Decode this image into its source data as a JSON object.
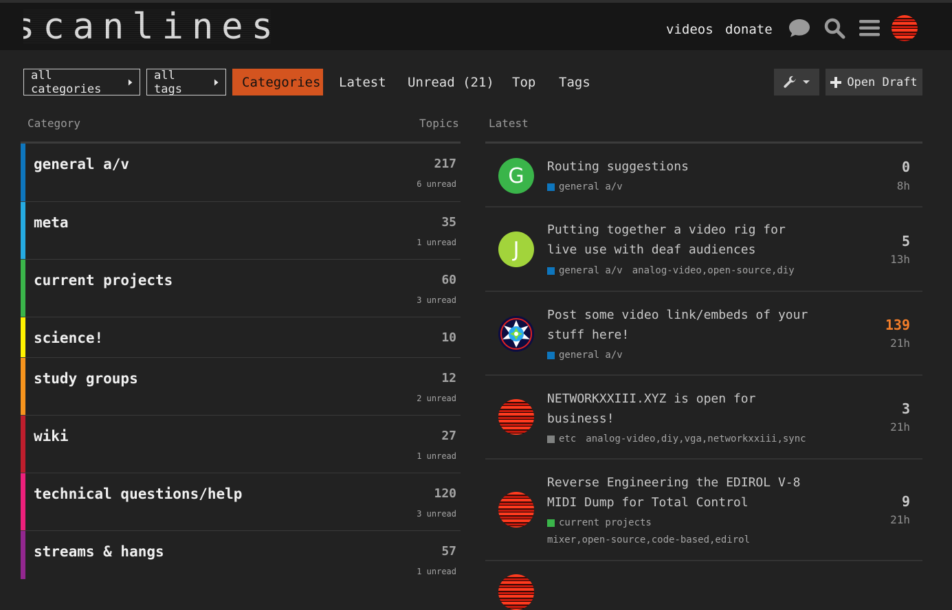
{
  "header": {
    "logo_text": "scanlines",
    "nav": {
      "videos": "videos",
      "donate": "donate"
    },
    "icons": [
      "chat-icon",
      "search-icon",
      "hamburger-menu-icon",
      "user-avatar"
    ]
  },
  "filters": {
    "categories_dropdown": "all categories",
    "tags_dropdown": "all tags"
  },
  "tabs": [
    {
      "label": "Categories",
      "active": true
    },
    {
      "label": "Latest",
      "active": false
    },
    {
      "label": "Unread (21)",
      "active": false
    },
    {
      "label": "Top",
      "active": false
    },
    {
      "label": "Tags",
      "active": false
    }
  ],
  "toolbar": {
    "open_draft": "Open Draft"
  },
  "columns": {
    "category": "Category",
    "topics": "Topics",
    "latest": "Latest"
  },
  "categories": [
    {
      "name": "general a/v",
      "topics": "217",
      "unread": "6 unread",
      "color": "#0e76bd"
    },
    {
      "name": "meta",
      "topics": "35",
      "unread": "1 unread",
      "color": "#25aae1"
    },
    {
      "name": "current projects",
      "topics": "60",
      "unread": "3 unread",
      "color": "#3ab54a"
    },
    {
      "name": "science!",
      "topics": "10",
      "unread": "",
      "color": "#fff200"
    },
    {
      "name": "study groups",
      "topics": "12",
      "unread": "2 unread",
      "color": "#f7941d"
    },
    {
      "name": "wiki",
      "topics": "27",
      "unread": "1 unread",
      "color": "#be1e2d"
    },
    {
      "name": "technical questions/help",
      "topics": "120",
      "unread": "3 unread",
      "color": "#ed207b"
    },
    {
      "name": "streams & hangs",
      "topics": "57",
      "unread": "1 unread",
      "color": "#92278f"
    }
  ],
  "latest": [
    {
      "title": "Routing suggestions",
      "category": "general a/v",
      "category_color": "#0e76bd",
      "tags": "",
      "tags2": "",
      "replies": "0",
      "age": "8h",
      "avatar": "G",
      "avatar_color": "#3ab54a"
    },
    {
      "title": "Putting together a video rig for live use with deaf audiences",
      "category": "general a/v",
      "category_color": "#0e76bd",
      "tags": "analog-video,open-source,diy",
      "tags2": "",
      "replies": "5",
      "age": "13h",
      "avatar": "J",
      "avatar_color": "#a2d43b"
    },
    {
      "title": "Post some video link/embeds of your stuff here!",
      "category": "general a/v",
      "category_color": "#0e76bd",
      "tags": "",
      "tags2": "",
      "replies": "139",
      "replies_color": "#f47e2a",
      "age": "21h",
      "avatar": "",
      "avatar_color": "#1a1a5a"
    },
    {
      "title": "NETWORKXXIII.XYZ is open for business!",
      "category": "etc",
      "category_color": "#808281",
      "tags": "analog-video,diy,vga,networkxxiii,sync",
      "tags2": "",
      "replies": "3",
      "age": "21h",
      "avatar": "",
      "avatar_color": "stripes"
    },
    {
      "title": "Reverse Engineering the EDIROL V-8 MIDI Dump for Total Control",
      "category": "current projects",
      "category_color": "#3ab54a",
      "tags": "",
      "tags2": "mixer,open-source,code-based,edirol",
      "replies": "9",
      "age": "21h",
      "avatar": "",
      "avatar_color": "stripes"
    }
  ]
}
